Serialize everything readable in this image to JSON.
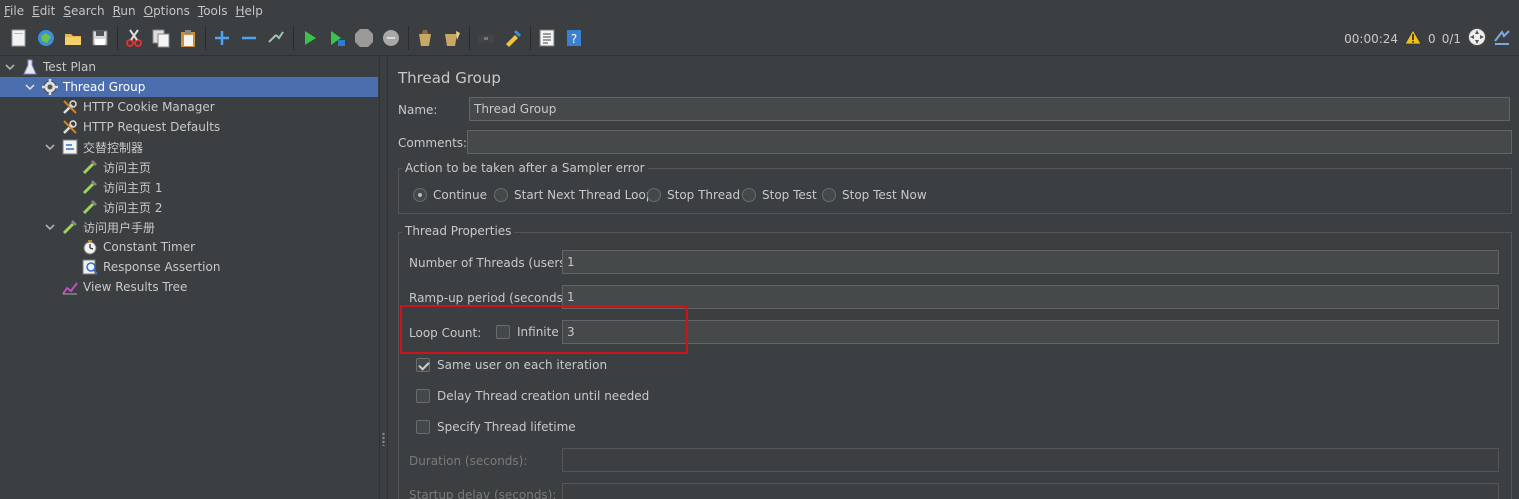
{
  "menu": [
    "File",
    "Edit",
    "Search",
    "Run",
    "Options",
    "Tools",
    "Help"
  ],
  "toolbar": {
    "icons": [
      "new-icon",
      "templates-icon",
      "open-icon",
      "save-icon",
      "cut-icon",
      "copy-icon",
      "paste-icon",
      "expand-icon",
      "collapse-icon",
      "toggle-icon",
      "start-icon",
      "start-no-pause-icon",
      "stop-icon",
      "shutdown-icon",
      "clear-icon",
      "clear-all-icon",
      "search-icon",
      "reset-search-icon",
      "function-helper-icon",
      "help-icon"
    ],
    "timer": "00:00:24",
    "warnings": "0",
    "threads": "0/1"
  },
  "tree": [
    {
      "label": "Test Plan",
      "icon": "test-plan-icon",
      "level": 0,
      "expanded": true
    },
    {
      "label": "Thread Group",
      "icon": "gear-icon",
      "level": 1,
      "expanded": true,
      "selected": true
    },
    {
      "label": "HTTP Cookie Manager",
      "icon": "wrench-icon",
      "level": 2
    },
    {
      "label": "HTTP Request Defaults",
      "icon": "wrench-icon",
      "level": 2
    },
    {
      "label": "交替控制器",
      "icon": "controller-icon",
      "level": 2,
      "expanded": true
    },
    {
      "label": "访问主页",
      "icon": "pipette-icon",
      "level": 3
    },
    {
      "label": "访问主页 1",
      "icon": "pipette-icon",
      "level": 3
    },
    {
      "label": "访问主页 2",
      "icon": "pipette-icon",
      "level": 3
    },
    {
      "label": "访问用户手册",
      "icon": "pipette-icon",
      "level": 2,
      "expanded": true
    },
    {
      "label": "Constant Timer",
      "icon": "timer-icon",
      "level": 3
    },
    {
      "label": "Response Assertion",
      "icon": "assertion-icon",
      "level": 3
    },
    {
      "label": "View Results Tree",
      "icon": "chart-icon",
      "level": 2
    }
  ],
  "panel": {
    "title": "Thread Group",
    "name_label": "Name:",
    "name_value": "Thread Group",
    "comments_label": "Comments:",
    "comments_value": "",
    "action_group_label": "Action to be taken after a Sampler error",
    "actions": [
      "Continue",
      "Start Next Thread Loop",
      "Stop Thread",
      "Stop Test",
      "Stop Test Now"
    ],
    "selected_action": "Continue",
    "props_group_label": "Thread Properties",
    "threads_label": "Number of Threads (users):",
    "threads_value": "1",
    "rampup_label": "Ramp-up period (seconds):",
    "rampup_value": "1",
    "loop_label": "Loop Count:",
    "infinite_label": "Infinite",
    "infinite_checked": false,
    "loop_value": "3",
    "same_user_label": "Same user on each iteration",
    "same_user_checked": true,
    "delay_label": "Delay Thread creation until needed",
    "delay_checked": false,
    "lifetime_label": "Specify Thread lifetime",
    "lifetime_checked": false,
    "duration_label": "Duration (seconds):",
    "duration_value": "",
    "startup_label": "Startup delay (seconds):",
    "startup_value": ""
  },
  "colors": {
    "selection": "#4b6eaf",
    "highlight": "#d0121c",
    "background": "#3c3f41"
  }
}
